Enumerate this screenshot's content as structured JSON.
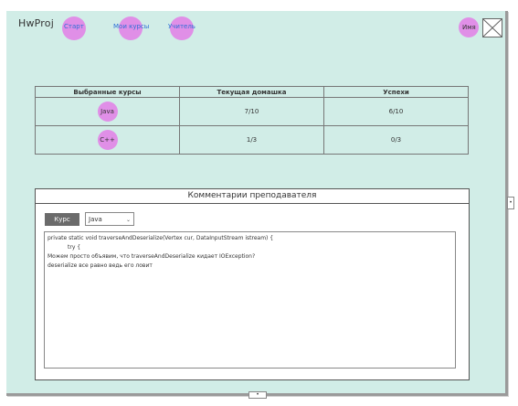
{
  "header": {
    "logo": "HwProj",
    "nav": [
      {
        "label": "Старт"
      },
      {
        "label": "Мои курсы"
      },
      {
        "label": "Учитель"
      }
    ],
    "user_name": "Имя"
  },
  "courses_table": {
    "columns": [
      "Выбранные курсы",
      "Текущая домашка",
      "Успехи"
    ],
    "rows": [
      {
        "course": "Java",
        "current": "7/10",
        "progress": "6/10"
      },
      {
        "course": "C++",
        "current": "1/3",
        "progress": "0/3"
      }
    ]
  },
  "comments_panel": {
    "title": "Комментарии преподавателя",
    "course_label": "Курс",
    "course_selected": "Java",
    "lines": [
      "private  static void traverseAndDeserialize(Vertex cur, DataInputStream istream) {",
      "try {",
      "Можем просто объявим, что traverseAndDeserialize кидает IOException?",
      "deserialize все равно ведь его ловит"
    ]
  },
  "colors": {
    "background": "#d1ede7",
    "highlight": "#e08fe7",
    "link": "#2c6fd6"
  }
}
